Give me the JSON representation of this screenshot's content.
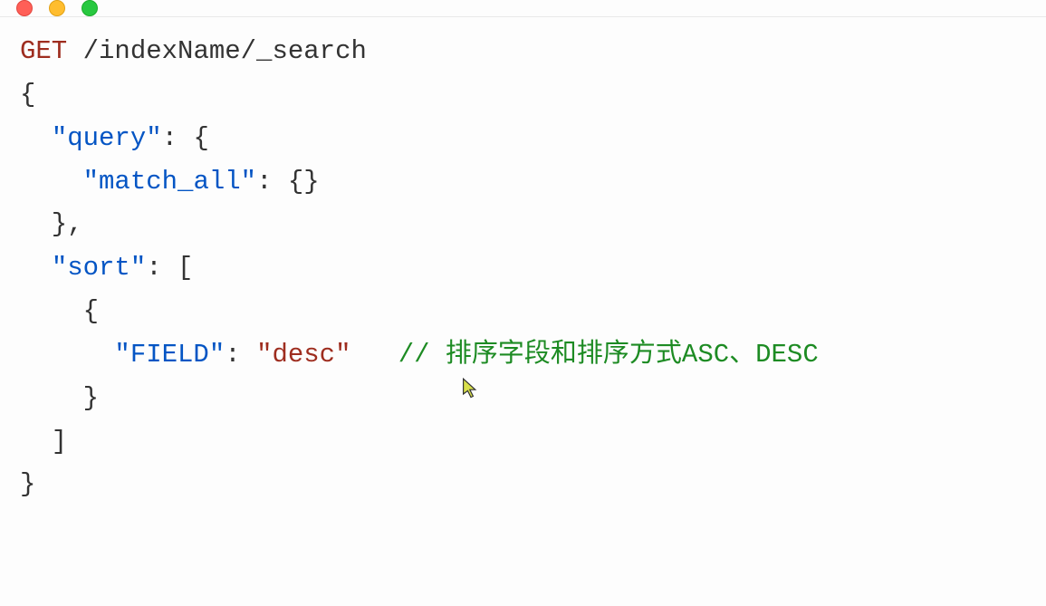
{
  "titlebar": {
    "close_name": "close",
    "minimize_name": "minimize",
    "maximize_name": "maximize"
  },
  "code": {
    "method": "GET",
    "path": "/indexName/_search",
    "line2": "{",
    "line3_indent": "  ",
    "line3_key": "\"query\"",
    "line3_after": ": {",
    "line4_indent": "    ",
    "line4_key": "\"match_all\"",
    "line4_after": ": {}",
    "line5": "  },",
    "line6_indent": "  ",
    "line6_key": "\"sort\"",
    "line6_after": ": [",
    "line7": "    {",
    "line8_indent": "      ",
    "line8_key": "\"FIELD\"",
    "line8_colon": ": ",
    "line8_value": "\"desc\"",
    "line8_gap": "   ",
    "line8_comment": "// 排序字段和排序方式ASC、DESC",
    "line9": "    }",
    "line10": "  ]",
    "line11": "}"
  }
}
